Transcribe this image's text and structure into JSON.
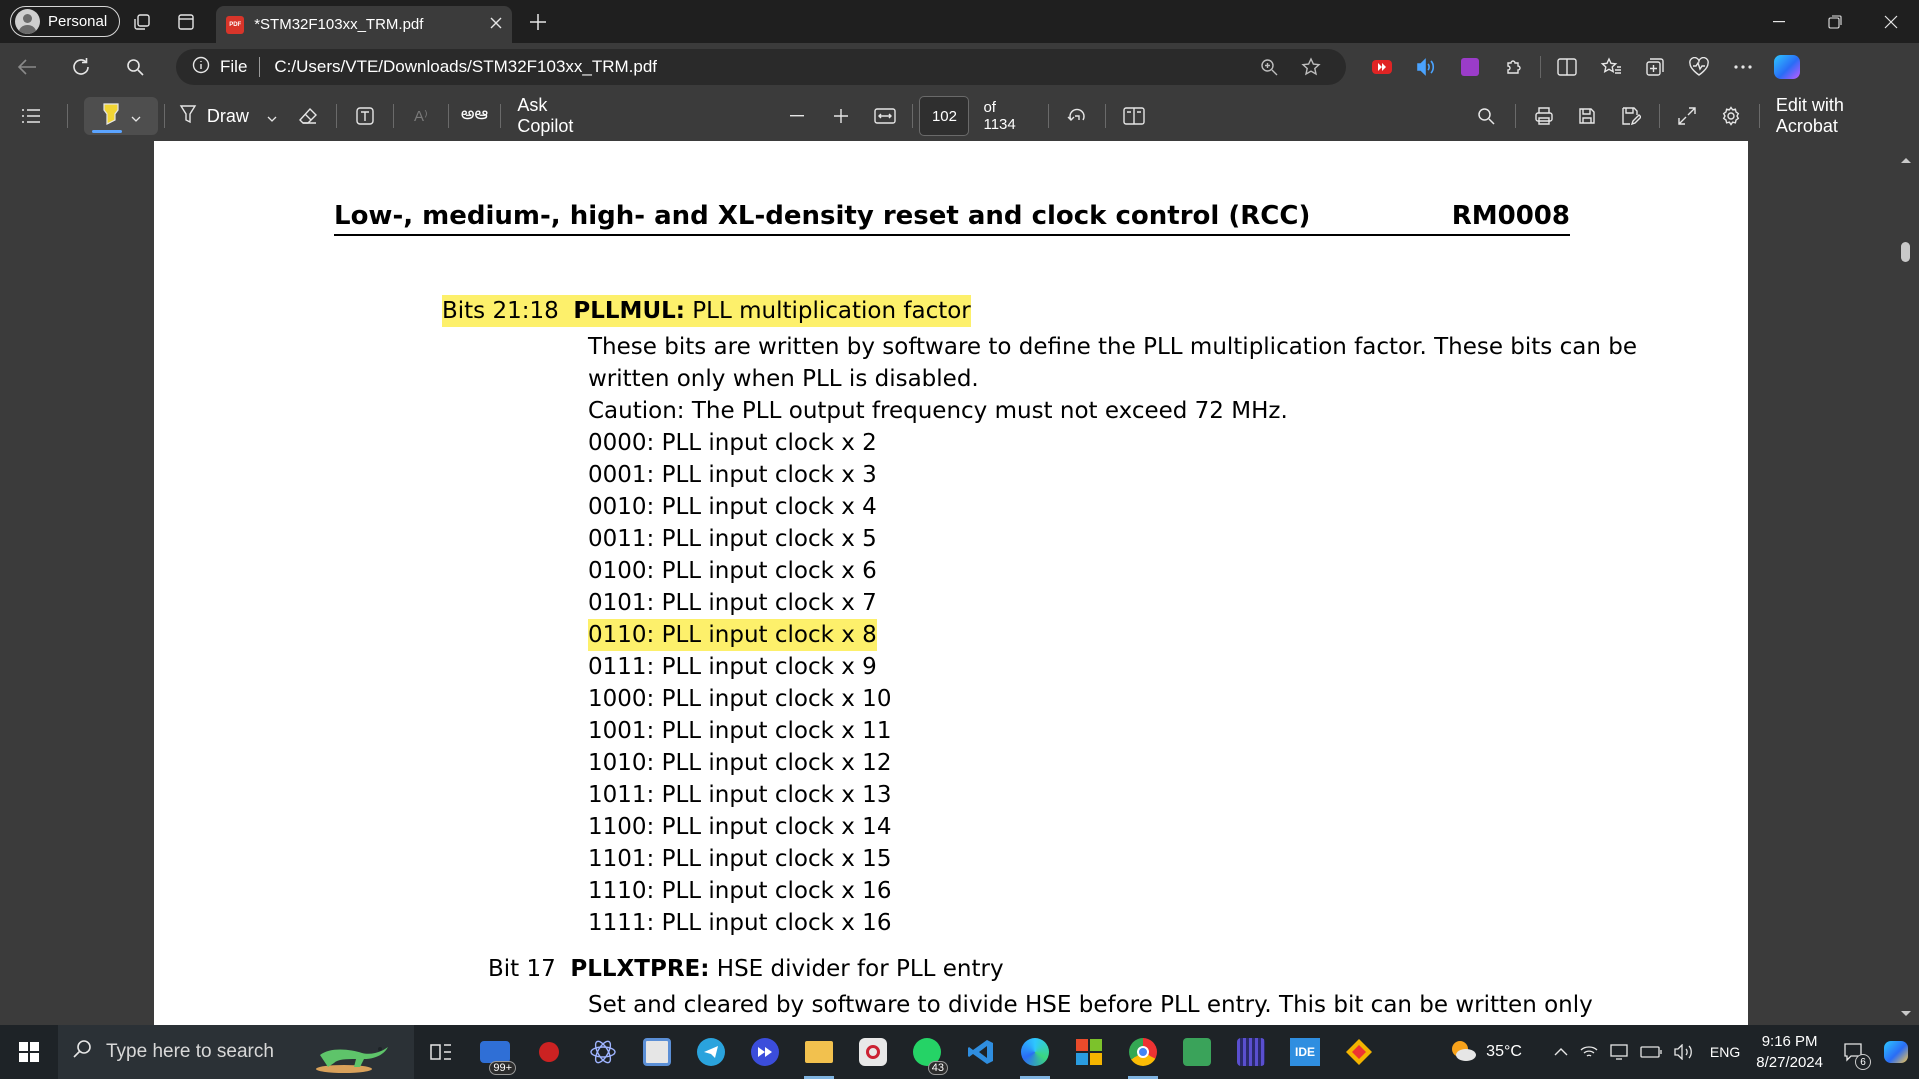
{
  "browser": {
    "profile_label": "Personal",
    "tab_title": "*STM32F103xx_TRM.pdf",
    "pdf_badge": "PDF",
    "address": {
      "scheme_label": "File",
      "url": "C:/Users/VTE/Downloads/STM32F103xx_TRM.pdf"
    }
  },
  "pdf_toolbar": {
    "draw_label": "Draw",
    "read_aloud_label": "A⁾",
    "translate_label": "అఆ",
    "ask_copilot_label": "Ask Copilot",
    "page_number": "102",
    "page_total": "of 1134",
    "edit_acrobat_label": "Edit with Acrobat"
  },
  "document": {
    "header_title": "Low-, medium-, high- and XL-density reset and clock control (RCC)",
    "header_ref": "RM0008",
    "pllmul": {
      "bits": "Bits 21:18",
      "name": "PLLMUL:",
      "desc": "PLL multiplication factor"
    },
    "para_line1": "These bits are written by software to define the PLL multiplication factor. These bits can be",
    "para_line2": "written only when PLL is disabled.",
    "caution": "Caution: The PLL output frequency must not exceed 72 MHz.",
    "values": [
      "0000: PLL input clock x 2",
      "0001: PLL input clock x 3",
      "0010: PLL input clock x 4",
      "0011: PLL input clock x 5",
      "0100: PLL input clock x 6",
      "0101: PLL input clock x 7",
      "0110: PLL input clock x 8",
      "0111: PLL input clock x 9",
      "1000: PLL input clock x 10",
      "1001: PLL input clock x 11",
      "1010: PLL input clock x 12",
      "1011: PLL input clock x 13",
      "1100: PLL input clock x 14",
      "1101: PLL input clock x 15",
      "1110: PLL input clock x 16",
      "1111: PLL input clock x 16"
    ],
    "highlighted_value": "0110: PLL input clock x 8",
    "pllxtpre": {
      "bits": "Bit 17",
      "name": "PLLXTPRE:",
      "desc": "HSE divider for PLL entry"
    },
    "pllxtpre_line1": "Set and cleared by software to divide HSE before PLL entry. This bit can be written only",
    "highlight_color": "#fdf06b"
  },
  "taskbar": {
    "search_placeholder": "Type here to search",
    "mail_badge": "99+",
    "whatsapp_badge": "43",
    "ide_label": "IDE",
    "weather": "35°C",
    "language": "ENG",
    "time": "9:16 PM",
    "date": "8/27/2024",
    "notifications": "6"
  }
}
